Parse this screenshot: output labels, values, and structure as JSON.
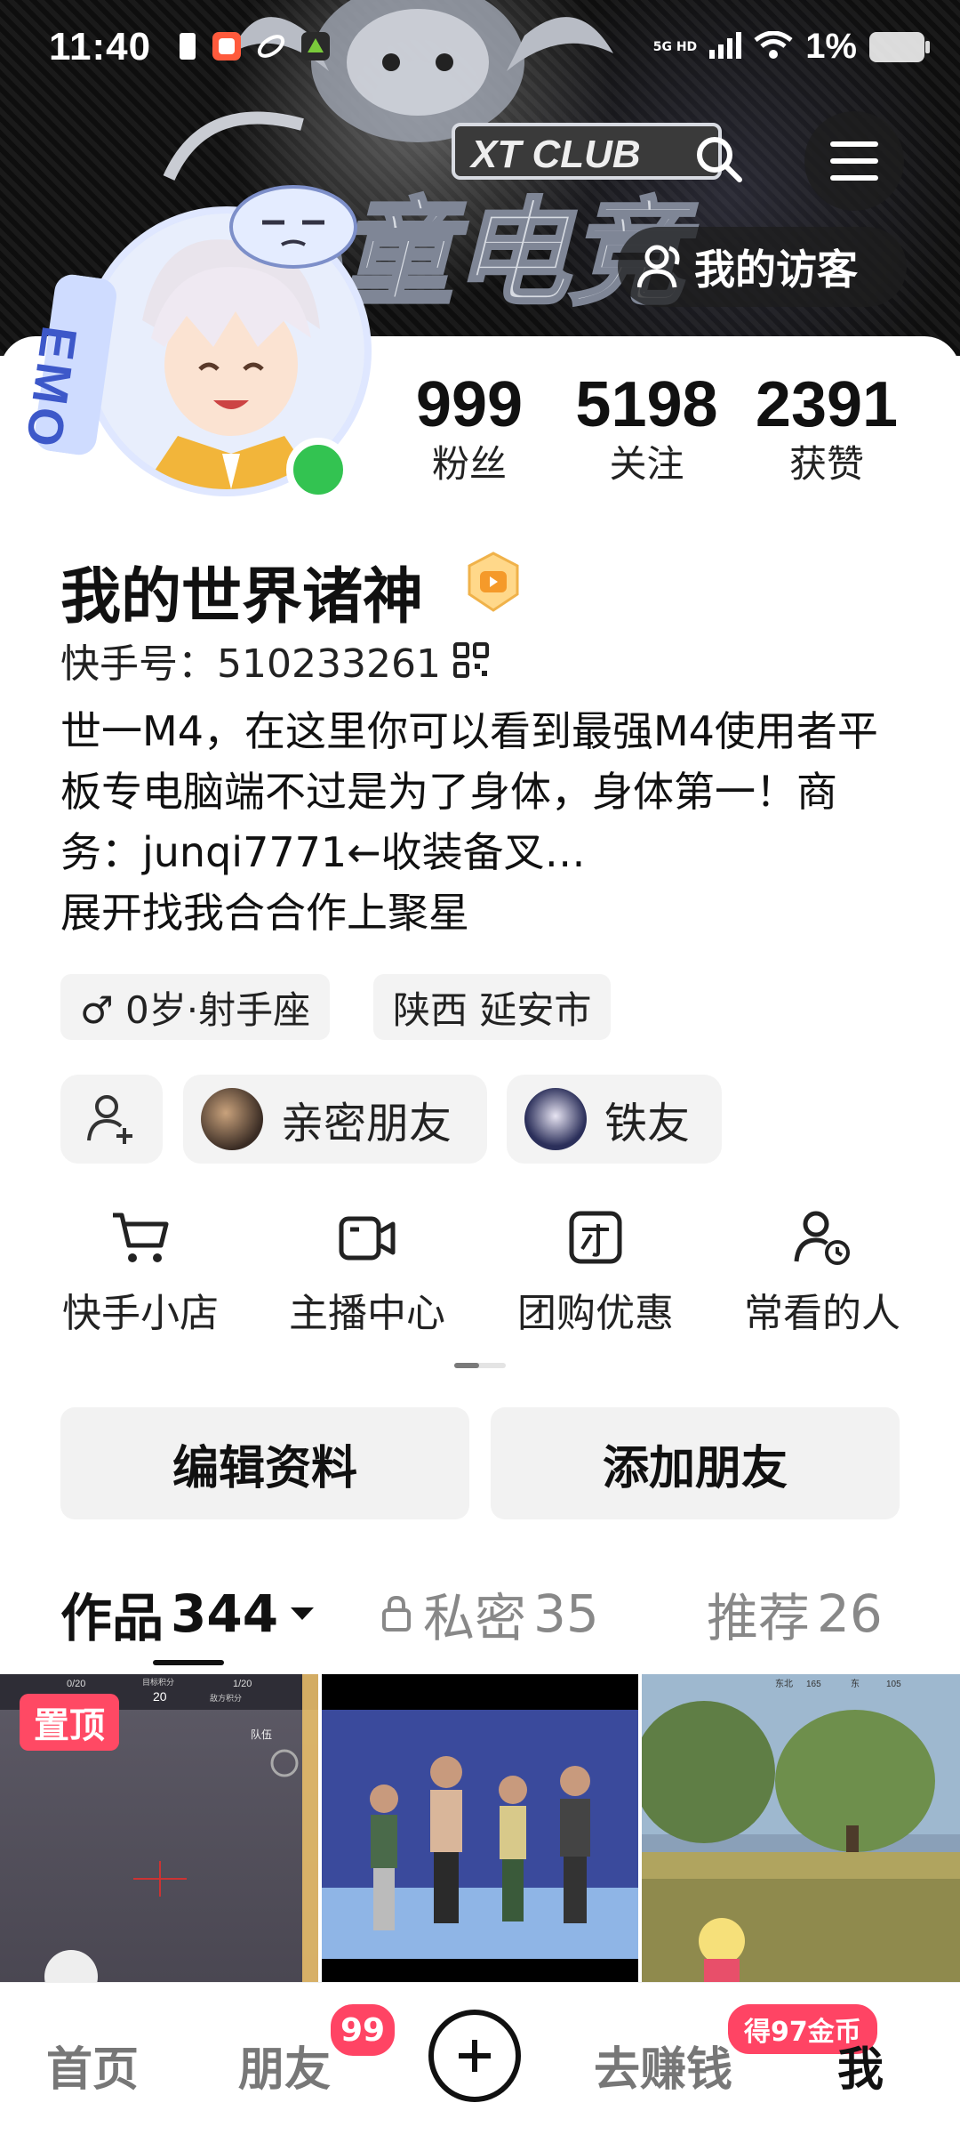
{
  "status_bar": {
    "time": "11:40",
    "network": "5G HD",
    "battery_percent": "1%"
  },
  "header": {
    "banner_text_top": "XT CLUB",
    "banner_text_main": "小童电竞",
    "visitor_label": "我的访客",
    "menu_icon": "menu-icon",
    "search_icon": "search-icon"
  },
  "profile": {
    "name": "我的世界诸神",
    "id_label": "快手号：510233261",
    "bio": "世一M4，在这里你可以看到最强M4使用者平板专电脑端不过是为了身体，身体第一！商务：junqi7771←收装备叉…",
    "bio_more": "展开",
    "bio_tail": "找我合合作上聚星",
    "emo_text": "EMO",
    "tags": [
      "♂ 0岁·射手座",
      "陕西 延安市"
    ]
  },
  "stats": [
    {
      "value": "999",
      "label": "粉丝"
    },
    {
      "value": "5198",
      "label": "关注"
    },
    {
      "value": "2391",
      "label": "获赞"
    }
  ],
  "friends": {
    "chips": [
      "亲密朋友",
      "铁友"
    ]
  },
  "quick_actions": [
    {
      "label": "快手小店",
      "icon": "cart-icon"
    },
    {
      "label": "主播中心",
      "icon": "camera-icon"
    },
    {
      "label": "团购优惠",
      "icon": "group-buy-icon"
    },
    {
      "label": "常看的人",
      "icon": "recent-people-icon"
    }
  ],
  "buttons": {
    "edit": "编辑资料",
    "add_friend": "添加朋友"
  },
  "tabs": {
    "works": "作品",
    "works_count": "344",
    "private": "私密",
    "private_count": "35",
    "recommend": "推荐",
    "recommend_count": "26"
  },
  "grid": {
    "pinned_label": "置顶",
    "thumb1_text": [
      "0/20",
      "目标积分",
      "20",
      "1/20",
      "队伍",
      "敌方积分"
    ],
    "thumb3_text": [
      "东北",
      "165",
      "东",
      "105"
    ]
  },
  "bottom_nav": {
    "home": "首页",
    "friends": "朋友",
    "friends_badge": "99",
    "earn": "去赚钱",
    "earn_badge": "得97金币",
    "me": "我"
  },
  "colors": {
    "accent_red": "#ff4464",
    "online_green": "#33c351",
    "chip_bg": "#f3f3f3"
  }
}
